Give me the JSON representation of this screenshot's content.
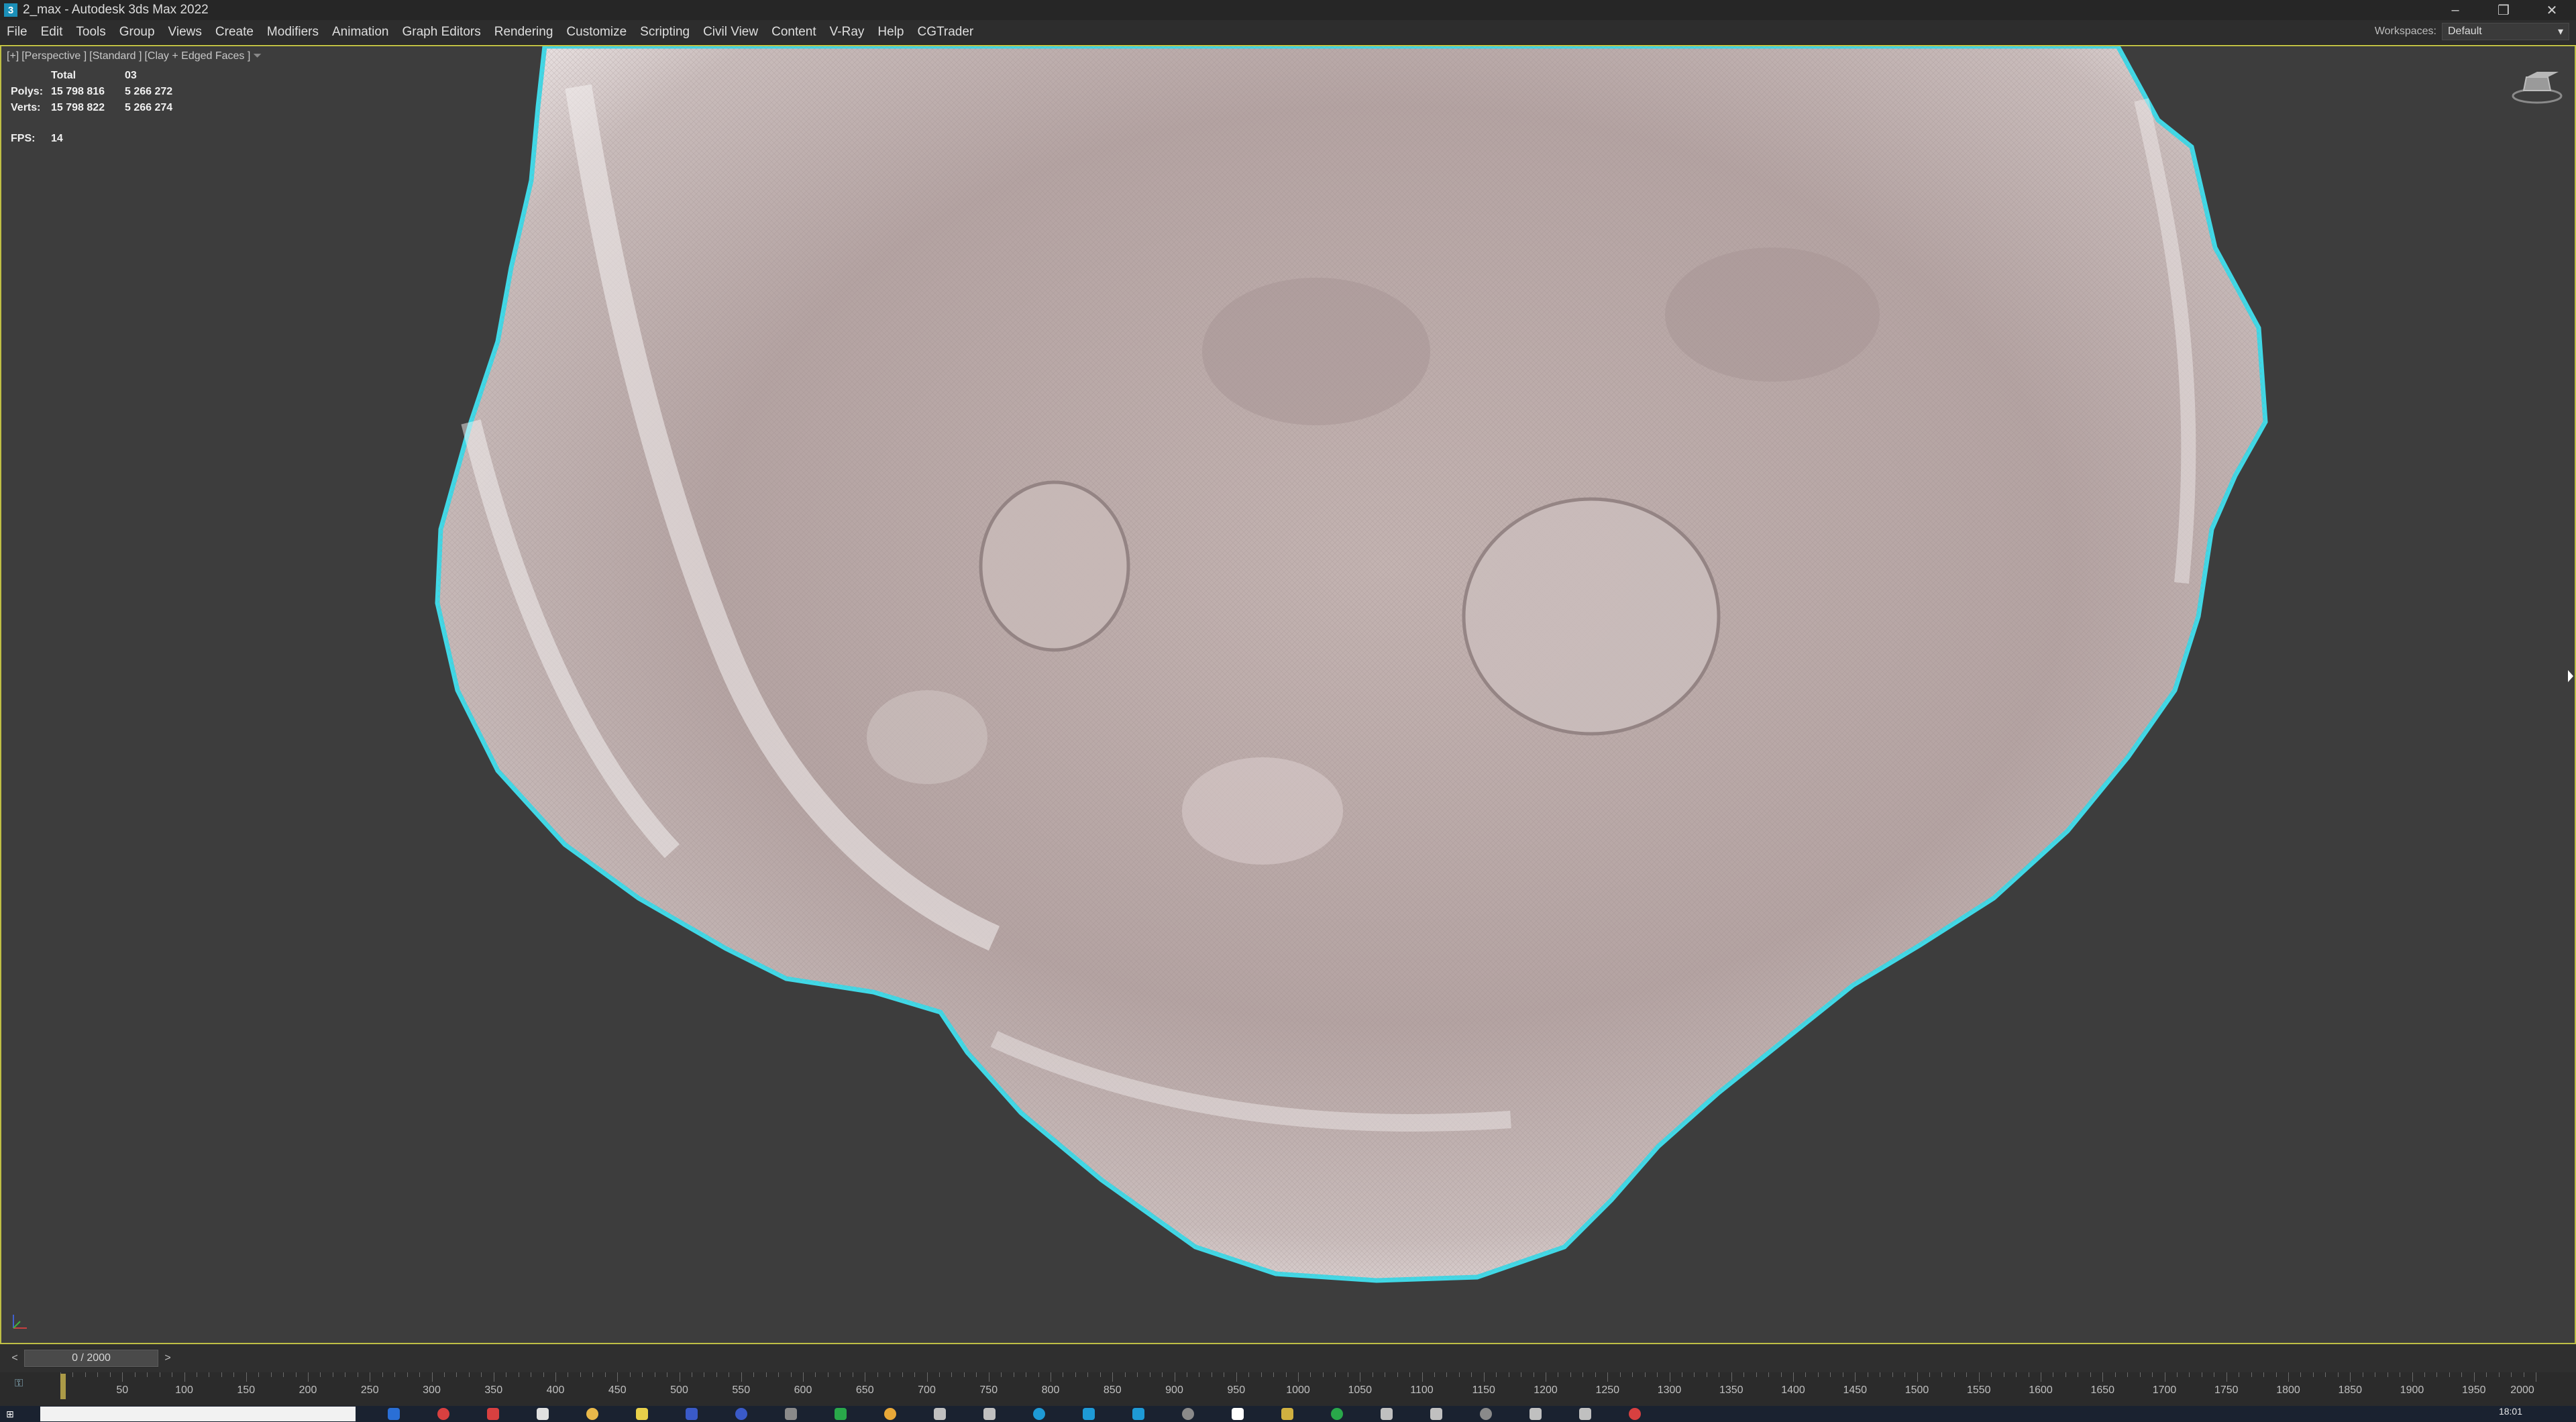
{
  "window": {
    "title": "2_max - Autodesk 3ds Max 2022",
    "app_icon_letter": "3",
    "controls": {
      "minimize": "–",
      "restore": "❐",
      "close": "✕"
    }
  },
  "menu": {
    "items": [
      "File",
      "Edit",
      "Tools",
      "Group",
      "Views",
      "Create",
      "Modifiers",
      "Animation",
      "Graph Editors",
      "Rendering",
      "Customize",
      "Scripting",
      "Civil View",
      "Content",
      "V-Ray",
      "Help",
      "CGTrader"
    ],
    "workspaces_label": "Workspaces:",
    "workspaces_value": "Default"
  },
  "viewport": {
    "label_parts": [
      "[+]",
      "[Perspective ]",
      "[Standard ]",
      "[Clay + Edged Faces ]"
    ],
    "stats": {
      "total_label": "Total",
      "total_value": "03",
      "polys_label": "Polys:",
      "polys_total": "15 798 816",
      "polys_value": "5 266 272",
      "verts_label": "Verts:",
      "verts_total": "15 798 822",
      "verts_value": "5 266 274",
      "fps_label": "FPS:",
      "fps_value": "14"
    },
    "colors": {
      "background": "#3d3d3d",
      "border": "#bfbf45",
      "selection_outline": "#40d8e6",
      "mesh": "#b9a9a8"
    }
  },
  "timeline": {
    "slider_text": "0 / 2000",
    "prev_arrow": "<",
    "next_arrow": ">",
    "ruler_labels": [
      "50",
      "100",
      "150",
      "200",
      "250",
      "300",
      "350",
      "400",
      "450",
      "500",
      "550",
      "600",
      "650",
      "700",
      "750",
      "800",
      "850",
      "900",
      "950",
      "1000",
      "1050",
      "1100",
      "1150",
      "1200",
      "1250",
      "1300",
      "1350",
      "1400",
      "1450",
      "1500",
      "1550",
      "1600",
      "1650",
      "1700",
      "1750",
      "1800",
      "1850",
      "1900",
      "1950",
      "2000"
    ],
    "ruler_max": 2000,
    "current_frame": 0
  },
  "taskbar": {
    "search_placeholder": "",
    "clock": "18:01",
    "icon_colors": [
      "#2a6fd6",
      "#d84040",
      "#d84040",
      "#e0e0e0",
      "#e8b84a",
      "#e8d04a",
      "#3a5ac8",
      "#3a5ac8",
      "#8a8a8a",
      "#29a84a",
      "#e8a838",
      "#c0c0c0",
      "#c0c0c0",
      "#1e9ad6",
      "#1e9ad6",
      "#1e9ad6",
      "#8a8a8a",
      "#ffffff",
      "#d0b040",
      "#29a84a",
      "#c0c0c0",
      "#c0c0c0",
      "#8a8a8a",
      "#c0c0c0",
      "#c0c0c0",
      "#d84040"
    ]
  }
}
